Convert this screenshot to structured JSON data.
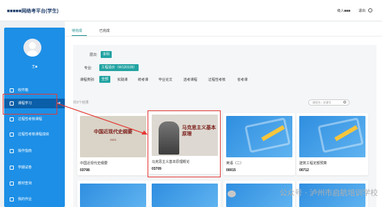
{
  "header": {
    "title": "■■■■■网络考平台(学生)",
    "user": "级入■■■",
    "logout": "退出"
  },
  "sidebar": {
    "username": "王■",
    "items": [
      {
        "label": "收件箱",
        "active": false
      },
      {
        "label": "课程学习",
        "active": true
      },
      {
        "label": "过程性考核课程",
        "active": false
      },
      {
        "label": "过程性考核课程成绩",
        "active": false
      },
      {
        "label": "操作指南",
        "active": false
      },
      {
        "label": "学期试卷",
        "active": false
      },
      {
        "label": "教材查询",
        "active": false
      },
      {
        "label": "我的作业",
        "active": false
      }
    ]
  },
  "tabs": [
    {
      "label": "待完成",
      "active": true
    },
    {
      "label": "已完成",
      "active": false
    }
  ],
  "filters": {
    "level_label": "层次:",
    "level_value": "本科",
    "major_label": "专业:",
    "major_value": "工程造价（W120105）",
    "type_label": "课程类别:",
    "types": [
      "全部",
      "实践课",
      "统考课",
      "毕业论文",
      "选考课程",
      "过程性考核",
      "省考课"
    ]
  },
  "count_text": "共9个结果",
  "search_placeholder": "课程名 / 关键字",
  "courses": [
    {
      "name": "中国近现代史纲要",
      "code": "03708",
      "cover_title": "中国近现代史纲要",
      "cover_sub": "2023"
    },
    {
      "name": "马克思主义基本原理概论",
      "code": "03709",
      "cover_title": "马克思主义基本原理"
    },
    {
      "name": "英语（二）",
      "code": "00015"
    },
    {
      "name": "建筑工程定额预算",
      "code": "00712"
    }
  ],
  "watermark": "公众号 · 泸州市启航培训学校",
  "colors": {
    "accent": "#22a3a2",
    "sidebar": "#1d8fe6",
    "highlight": "#e53935"
  }
}
